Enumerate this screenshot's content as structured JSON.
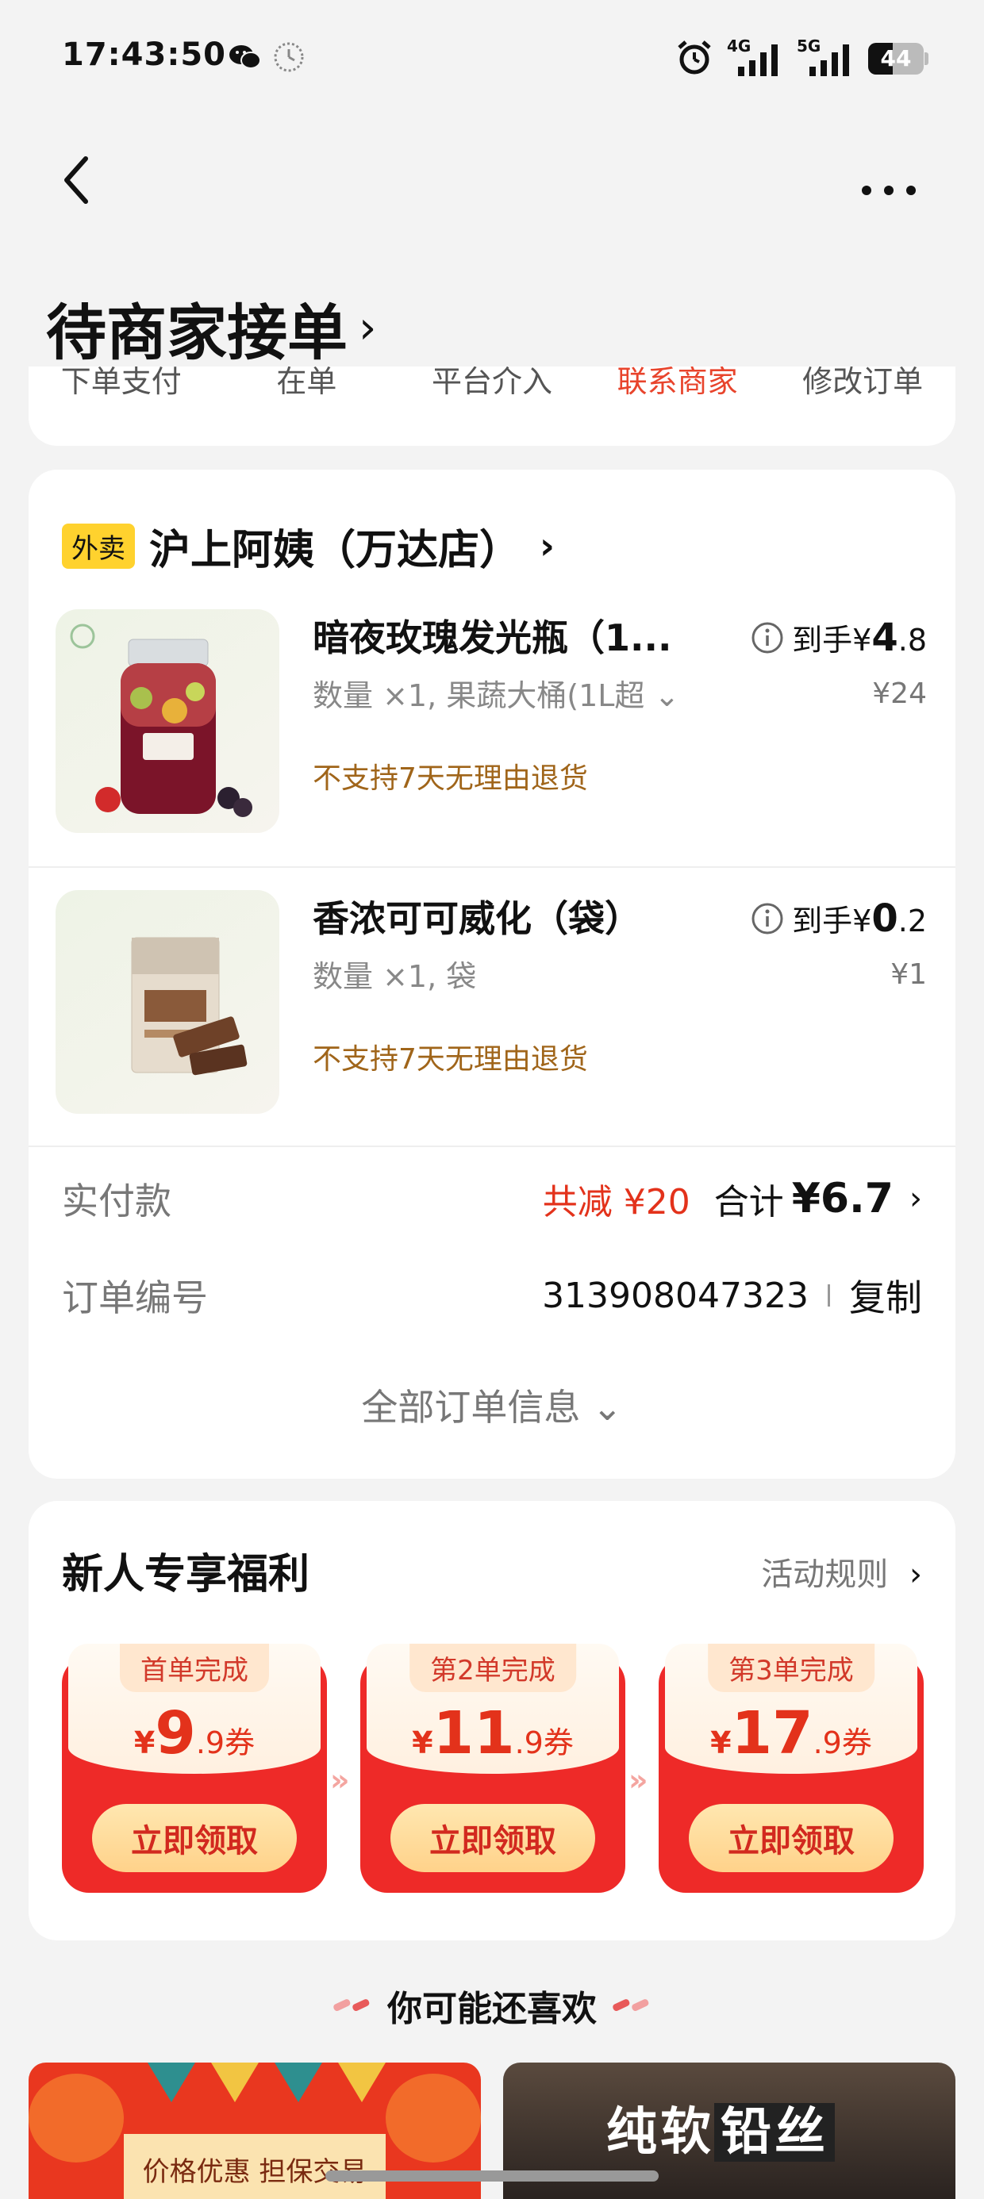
{
  "status": {
    "time": "17:43:50",
    "battery": "44",
    "battery_level": 0.44,
    "network_1": "4G",
    "network_2": "5G"
  },
  "header": {
    "title": "待商家接单",
    "title_chevron": "›"
  },
  "tracking": {
    "steps": [
      "下单支付",
      "在单",
      "平台介入",
      "联系商家",
      "修改订单"
    ],
    "active_index": 3,
    "active_color": "#e8442c"
  },
  "order": {
    "store_tag": "外卖",
    "store_name": "沪上阿姨（万达店）",
    "store_chevron": "›",
    "items": [
      {
        "title": "暗夜玫瑰发光瓶（1...",
        "spec": "数量 ×1, 果蔬大桶(1L超",
        "spec_more": "⌄",
        "policy": "不支持7天无理由退货",
        "price_prefix": "到手¥",
        "price_int": "4",
        "price_dec": ".8",
        "original_price": "¥24"
      },
      {
        "title": "香浓可可威化（袋）",
        "spec": "数量 ×1, 袋",
        "spec_more": "",
        "policy": "不支持7天无理由退货",
        "price_prefix": "到手¥",
        "price_int": "0",
        "price_dec": ".2",
        "original_price": "¥1"
      }
    ],
    "payment_label": "实付款",
    "discount_text": "共减 ¥20",
    "total_label": "合计",
    "total_value": "¥6.7",
    "total_chevron": "›",
    "order_no_label": "订单编号",
    "order_no": "313908047323",
    "copy_label": "复制",
    "all_info_label": "全部订单信息 ⌄"
  },
  "benefits": {
    "title": "新人专享福利",
    "rule_label": "活动规则",
    "rule_chevron": "›",
    "coupons": [
      {
        "tab": "首单完成",
        "yen": "¥",
        "num": "9",
        "dec": ".9券",
        "button": "立即领取"
      },
      {
        "tab": "第2单完成",
        "yen": "¥",
        "num": "11",
        "dec": ".9券",
        "button": "立即领取"
      },
      {
        "tab": "第3单完成",
        "yen": "¥",
        "num": "17",
        "dec": ".9券",
        "button": "立即领取"
      }
    ],
    "arrow_glyph": "»",
    "accent_color": "#ee2a28"
  },
  "recommend": {
    "title": "你可能还喜欢",
    "left_banner_text": "价格优惠 担保交易",
    "right_banner_text_1": "纯软",
    "right_banner_text_2": "铅丝"
  }
}
